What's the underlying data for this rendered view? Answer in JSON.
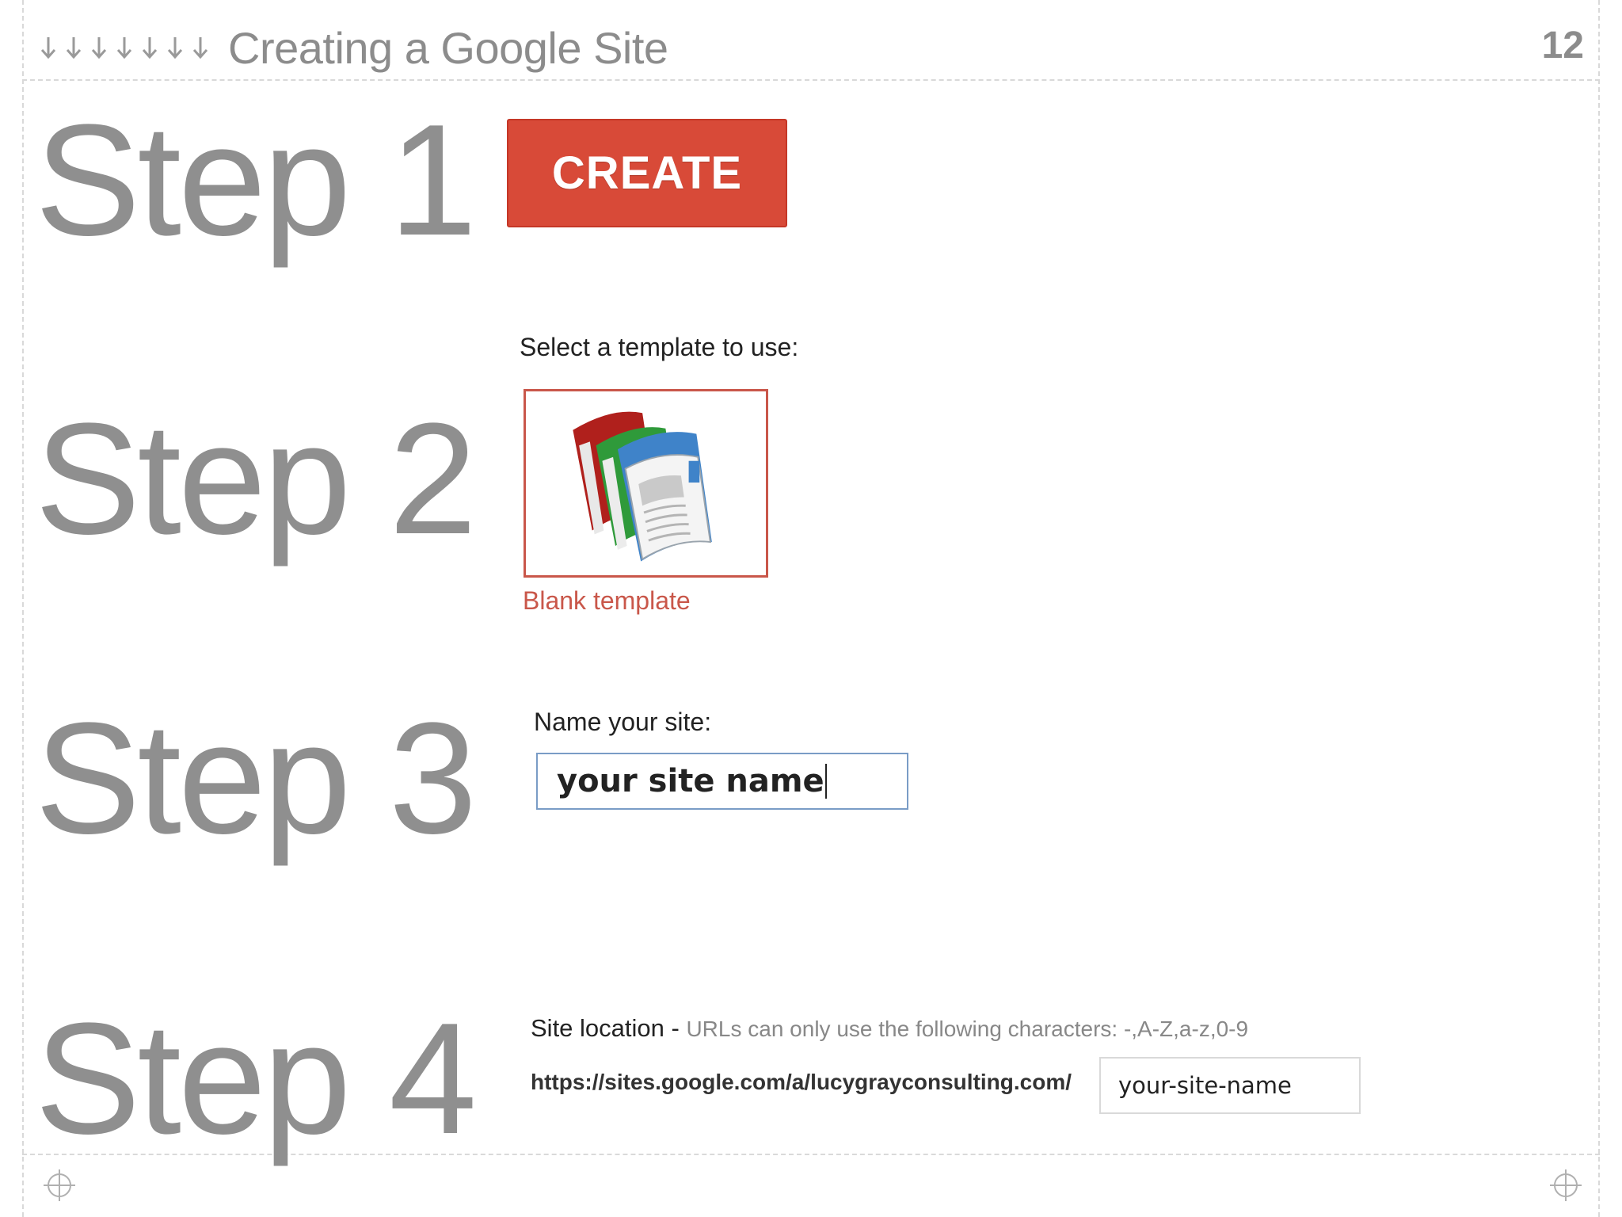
{
  "header": {
    "title": "Creating a Google Site",
    "page_number": "12",
    "arrow_icon_count": 7
  },
  "steps": [
    {
      "label": "Step 1"
    },
    {
      "label": "Step 2"
    },
    {
      "label": "Step 3"
    },
    {
      "label": "Step 4"
    }
  ],
  "step1": {
    "create_button_label": "CREATE",
    "button_color": "#d84a38"
  },
  "step2": {
    "prompt": "Select a template to use:",
    "template_name": "Blank template",
    "template_icon": "google-sites-template-icon",
    "accent_color": "#c9574a"
  },
  "step3": {
    "prompt": "Name your site:",
    "site_name_value": "your site name"
  },
  "step4": {
    "label": "Site location",
    "separator": " - ",
    "hint": "URLs can only use the following characters: -,A-Z,a-z,0-9",
    "url_prefix": "https://sites.google.com/a/lucygrayconsulting.com/",
    "site_path_value": "your-site-name"
  },
  "colors": {
    "step_text": "#8f8f8f",
    "header_text": "#8c8c8c",
    "input_border": "#7a9cc6"
  }
}
